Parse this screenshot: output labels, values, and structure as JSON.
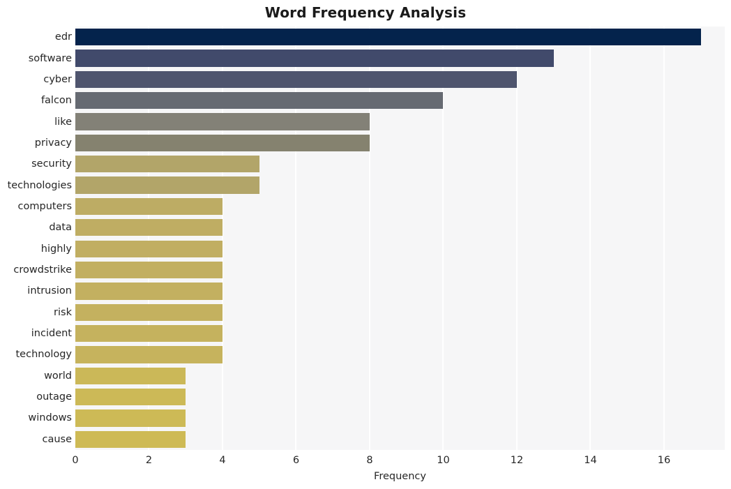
{
  "chart_data": {
    "type": "bar",
    "orientation": "horizontal",
    "title": "Word Frequency Analysis",
    "xlabel": "Frequency",
    "ylabel": "",
    "categories": [
      "edr",
      "software",
      "cyber",
      "falcon",
      "like",
      "privacy",
      "security",
      "technologies",
      "computers",
      "data",
      "highly",
      "crowdstrike",
      "intrusion",
      "risk",
      "incident",
      "technology",
      "world",
      "outage",
      "windows",
      "cause"
    ],
    "values": [
      17,
      13,
      12,
      10,
      8,
      8,
      5,
      5,
      4,
      4,
      4,
      4,
      4,
      4,
      4,
      4,
      3,
      3,
      3,
      3
    ],
    "bar_colors": [
      "#04234c",
      "#414a6b",
      "#4f556e",
      "#666a72",
      "#838177",
      "#85826f",
      "#b2a569",
      "#b2a569",
      "#bdac64",
      "#bfad63",
      "#c1ae62",
      "#c2af61",
      "#c3b060",
      "#c4b15f",
      "#c5b25e",
      "#c6b35d",
      "#cbb858",
      "#ccb957",
      "#cdba56",
      "#ceba55"
    ],
    "xlim": [
      0,
      17.65
    ],
    "xticks": [
      0,
      2,
      4,
      6,
      8,
      10,
      12,
      14,
      16
    ],
    "xtick_labels": [
      "0",
      "2",
      "4",
      "6",
      "8",
      "10",
      "12",
      "14",
      "16"
    ],
    "grid": "vertical-white",
    "legend": "none",
    "plot_background": "#f6f6f7",
    "figure_background": "#ffffff"
  }
}
